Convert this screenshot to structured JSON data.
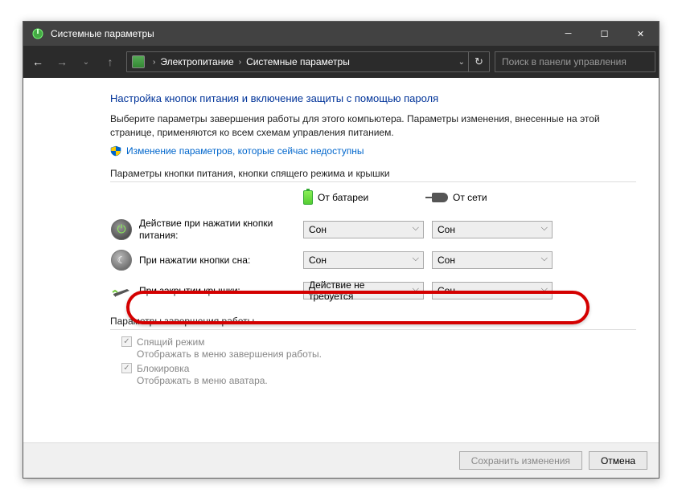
{
  "window": {
    "title": "Системные параметры"
  },
  "nav": {
    "crumb1": "Электропитание",
    "crumb2": "Системные параметры",
    "search_placeholder": "Поиск в панели управления"
  },
  "main": {
    "heading": "Настройка кнопок питания и включение защиты с помощью пароля",
    "description": "Выберите параметры завершения работы для этого компьютера. Параметры изменения, внесенные на этой странице, применяются ко всем схемам управления питанием.",
    "link": "Изменение параметров, которые сейчас недоступны",
    "section1_title": "Параметры кнопки питания, кнопки спящего режима и крышки",
    "col_battery": "От батареи",
    "col_ac": "От сети",
    "rows": [
      {
        "label": "Действие при нажатии кнопки питания:",
        "battery": "Сон",
        "ac": "Сон"
      },
      {
        "label": "При нажатии кнопки сна:",
        "battery": "Сон",
        "ac": "Сон"
      },
      {
        "label": "При закрытии крышки:",
        "battery": "Действие не требуется",
        "ac": "Сон"
      }
    ],
    "section2_title": "Параметры завершения работы",
    "checks": [
      {
        "label": "Спящий режим",
        "desc": "Отображать в меню завершения работы."
      },
      {
        "label": "Блокировка",
        "desc": "Отображать в меню аватара."
      }
    ]
  },
  "footer": {
    "save": "Сохранить изменения",
    "cancel": "Отмена"
  }
}
